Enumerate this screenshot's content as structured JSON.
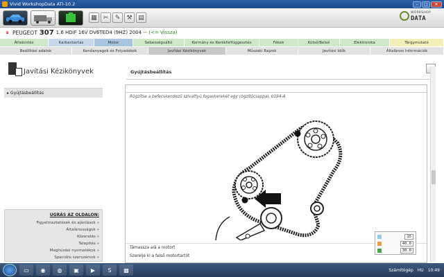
{
  "window": {
    "title": "Vivid WorkshopData ATI-10.2",
    "min": "–",
    "max": "□",
    "close": "✕"
  },
  "logo": {
    "line1": "WORKSHOP",
    "line2": "DATA"
  },
  "vehicle": {
    "make": "PEUGEOT",
    "model": "307",
    "desc": "1.6 HDiF 16V DV6TED4 (9HZ) 2004 --",
    "back": "(<= Vissza)"
  },
  "tabs": [
    {
      "label": "Áttekintés",
      "color": "green"
    },
    {
      "label": "Karbantartás",
      "color": "blue"
    },
    {
      "label": "Motor",
      "color": "active"
    },
    {
      "label": "Sebességváltó",
      "color": "green"
    },
    {
      "label": "Kormány és Kerékfelfüggesztés",
      "color": "green"
    },
    {
      "label": "Fékek",
      "color": "green"
    },
    {
      "label": "Külső/Belső",
      "color": "green"
    },
    {
      "label": "Elektronika",
      "color": "green"
    },
    {
      "label": "Tárgymutató",
      "color": "yellow"
    }
  ],
  "subtabs": [
    {
      "label": "Beállítási adatok"
    },
    {
      "label": "Kenőanyagok és Folyadékok"
    },
    {
      "label": "Javítási Kézikönyvek"
    },
    {
      "label": "Műszaki Rajzok"
    },
    {
      "label": "Javítási Idők"
    },
    {
      "label": "Általános Információk"
    }
  ],
  "left": {
    "heading": "Javítási Kézikönyvek",
    "items": [
      "Gyújtásbeállítás"
    ],
    "jump_title": "UGRÁS AZ OLDALON:",
    "jump_links": [
      "Figyelmeztetések és ajánlások »",
      "Általánosságok »",
      "Közerelés »",
      "Telepítés »",
      "Meghúzási nyomatékok »",
      "Speciális szerszámok »"
    ]
  },
  "content": {
    "title": "Gyújtásbeállítás",
    "instruction": "Rögzítse a befecskendező szivattyú fogaskerekét egy rögzítőcsappal, 0194-A",
    "step2": "Támassza alá a motort",
    "step3": "Szerelje ki a felső motortartót"
  },
  "legend": {
    "v1": "15",
    "v2": "40.0",
    "v3": "30.0"
  },
  "taskbar": {
    "tray_label": "Számítógép",
    "lang": "HU",
    "time": "10:49"
  }
}
